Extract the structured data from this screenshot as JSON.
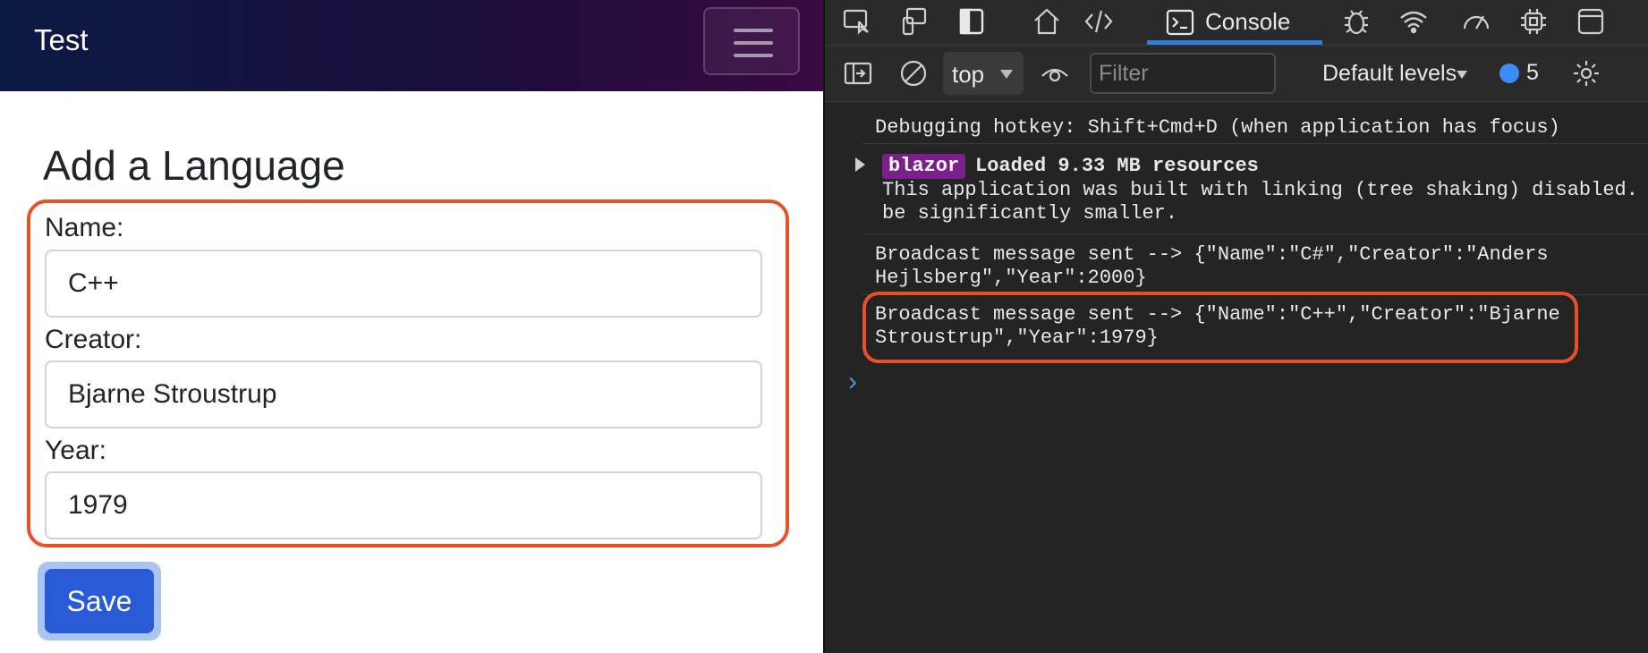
{
  "app": {
    "brand": "Test",
    "page_title": "Add a Language",
    "form": {
      "name_label": "Name:",
      "name_value": "C++",
      "creator_label": "Creator:",
      "creator_value": "Bjarne Stroustrup",
      "year_label": "Year:",
      "year_value": "1979"
    },
    "save_label": "Save"
  },
  "devtools": {
    "tabs": [
      "element-picker-icon",
      "device-mode-icon",
      "dock-icon",
      "home-icon",
      "sources-icon",
      "console-icon",
      "debug-icon",
      "network-icon",
      "performance-icon",
      "memory-icon",
      "window-icon"
    ],
    "active_tab": "Console",
    "context": "top",
    "filter_placeholder": "Filter",
    "levels": "Default levels",
    "message_count": "5",
    "console": {
      "hotkey": "Debugging hotkey: Shift+Cmd+D (when application has focus)",
      "badge": "blazor",
      "loaded": "Loaded 9.33 MB resources",
      "linking_1": "This application was built with linking (tree shaking) disabled.",
      "linking_2": "be significantly smaller.",
      "msg1_line1": "Broadcast message sent --> {\"Name\":\"C#\",\"Creator\":\"Anders",
      "msg1_line2": "Hejlsberg\",\"Year\":2000}",
      "msg2_line1": "Broadcast message sent --> {\"Name\":\"C++\",\"Creator\":\"Bjarne",
      "msg2_line2": "Stroustrup\",\"Year\":1979}",
      "prompt": "›"
    }
  },
  "colors": {
    "highlight": "#e8502a",
    "save_button": "#2a5bd7",
    "console_tab_underline": "#2f7fd8",
    "badge": "#7b1f8a"
  }
}
